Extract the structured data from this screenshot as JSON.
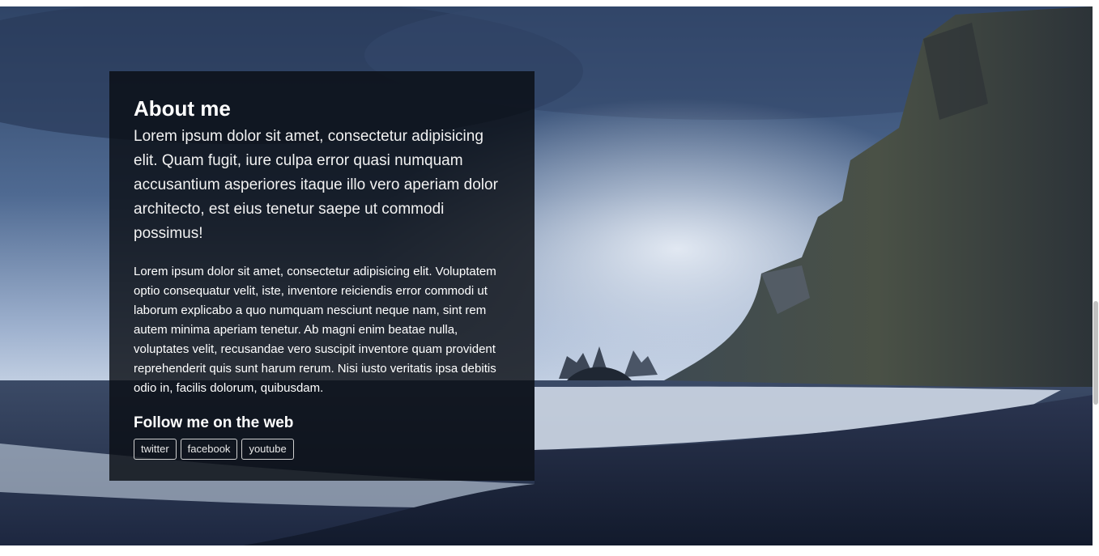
{
  "about": {
    "title": "About me",
    "lead": "Lorem ipsum dolor sit amet, consectetur adipisicing elit. Quam fugit, iure culpa error quasi numquam accusantium asperiores itaque illo vero aperiam dolor architecto, est eius tenetur saepe ut commodi possimus!",
    "body": "Lorem ipsum dolor sit amet, consectetur adipisicing elit. Voluptatem optio consequatur velit, iste, inventore reiciendis error commodi ut laborum explicabo a quo numquam nesciunt neque nam, sint rem autem minima aperiam tenetur. Ab magni enim beatae nulla, voluptates velit, recusandae vero suscipit inventore quam provident reprehenderit quis sunt harum rerum. Nisi iusto veritatis ipsa debitis odio in, facilis dolorum, quibusdam."
  },
  "follow": {
    "title": "Follow me on the web",
    "links": [
      {
        "label": "twitter"
      },
      {
        "label": "facebook"
      },
      {
        "label": "youtube"
      }
    ]
  },
  "colors": {
    "panel_background": "#0a0d14",
    "text": "#ffffff",
    "button_border": "#d0d0d0"
  }
}
